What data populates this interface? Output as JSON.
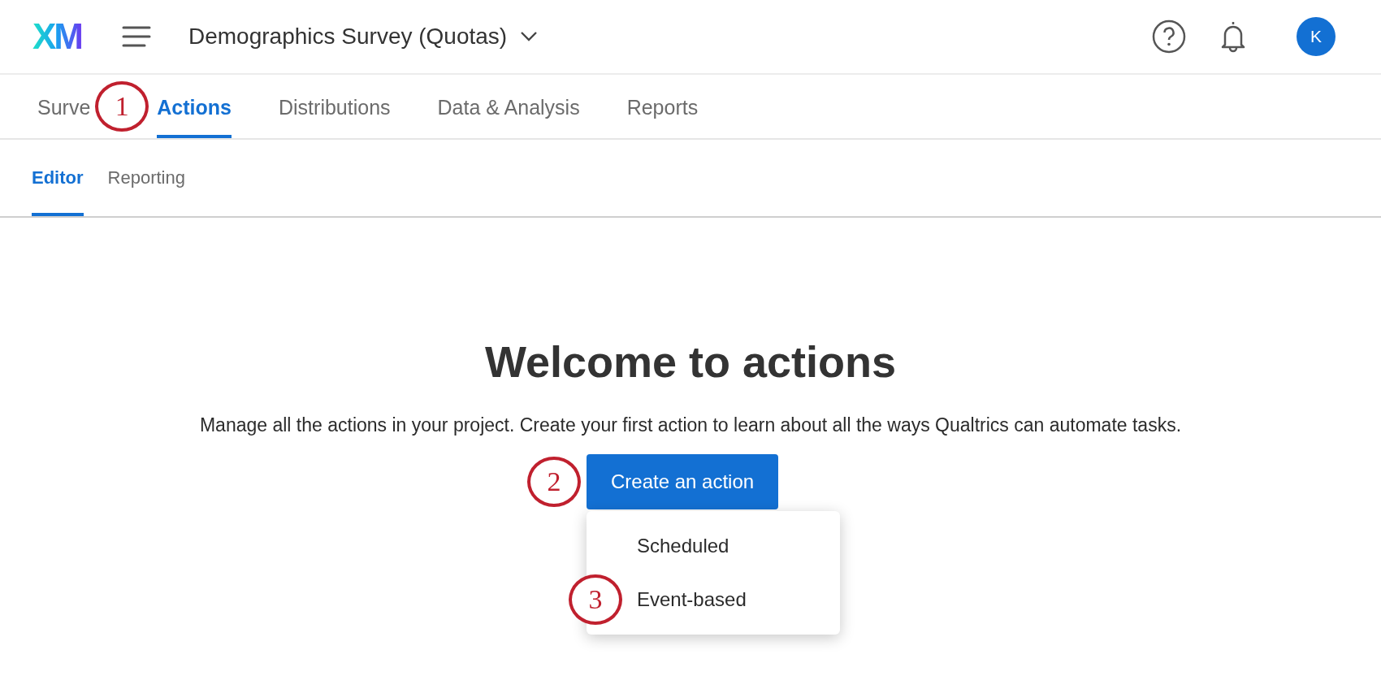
{
  "header": {
    "logo": "XM",
    "project_title": "Demographics Survey (Quotas)",
    "avatar_initial": "K"
  },
  "tabs": [
    {
      "label": "Surve",
      "selected": false
    },
    {
      "label": "Actions",
      "selected": true,
      "callout": "1"
    },
    {
      "label": "Distributions",
      "selected": false
    },
    {
      "label": "Data & Analysis",
      "selected": false
    },
    {
      "label": "Reports",
      "selected": false
    }
  ],
  "subtabs": [
    {
      "label": "Editor",
      "selected": true
    },
    {
      "label": "Reporting",
      "selected": false
    }
  ],
  "welcome": {
    "heading": "Welcome to actions",
    "description": "Manage all the actions in your project. Create your first action to learn about all the ways Qualtrics can automate tasks.",
    "button": "Create an action",
    "button_callout": "2"
  },
  "menu": [
    {
      "label": "Scheduled"
    },
    {
      "label": "Event-based",
      "callout": "3"
    }
  ]
}
